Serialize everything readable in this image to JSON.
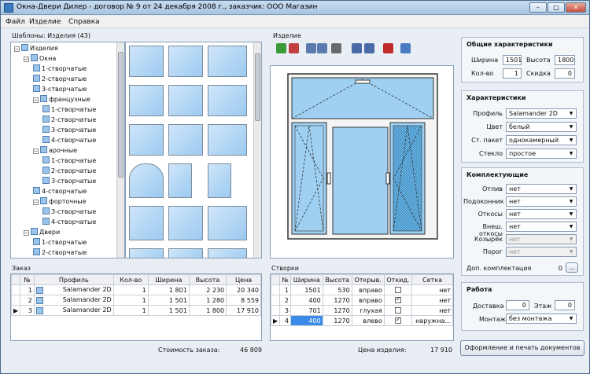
{
  "window": {
    "title": "Окна-Двери Дилер - договор № 9 от 24 декабря 2008 г., заказчик: ООО Магазин",
    "min": "–",
    "max": "□",
    "close": "✕"
  },
  "menu": [
    "Файл",
    "Изделие",
    "Справка"
  ],
  "templates": {
    "label": "Шаблоны: Изделия (43)",
    "tree": [
      {
        "text": "Изделия",
        "level": 0,
        "expander": "−"
      },
      {
        "text": "Окна",
        "level": 1,
        "expander": "−"
      },
      {
        "text": "1-створчатые",
        "level": 2
      },
      {
        "text": "2-створчатые",
        "level": 2
      },
      {
        "text": "3-створчатые",
        "level": 2
      },
      {
        "text": "французные",
        "level": 2,
        "expander": "−"
      },
      {
        "text": "1-створчатые",
        "level": 3
      },
      {
        "text": "2-створчатые",
        "level": 3
      },
      {
        "text": "3-створчатые",
        "level": 3
      },
      {
        "text": "4-створчатые",
        "level": 3
      },
      {
        "text": "арочные",
        "level": 2,
        "expander": "−"
      },
      {
        "text": "1-створчатые",
        "level": 3
      },
      {
        "text": "2-створчатые",
        "level": 3
      },
      {
        "text": "3-створчатые",
        "level": 3
      },
      {
        "text": "4-створчатые",
        "level": 2
      },
      {
        "text": "форточные",
        "level": 2,
        "expander": "−"
      },
      {
        "text": "3-створчатые",
        "level": 3
      },
      {
        "text": "4-створчатые",
        "level": 3
      },
      {
        "text": "Двери",
        "level": 1,
        "expander": "−"
      },
      {
        "text": "1-створчатые",
        "level": 2
      },
      {
        "text": "2-створчатые",
        "level": 2
      }
    ]
  },
  "product": {
    "label": "Изделие",
    "toolbar": [
      "zoom-in-icon",
      "zoom-out-icon",
      "align-left-icon",
      "align-right-icon",
      "menu-dropdown-icon",
      "copy-icon",
      "paste-icon",
      "delete-icon",
      "window-icon"
    ]
  },
  "order": {
    "label": "Заказ",
    "columns": [
      "№",
      "Профиль",
      "Кол-во",
      "Ширина",
      "Высота",
      "Цена"
    ],
    "rows": [
      {
        "n": "1",
        "profile": "Salamander 2D",
        "qty": "1",
        "w": "1 801",
        "h": "2 230",
        "price": "20 340"
      },
      {
        "n": "2",
        "profile": "Salamander 2D",
        "qty": "1",
        "w": "1 501",
        "h": "1 280",
        "price": "8 559"
      },
      {
        "n": "3",
        "profile": "Salamander 2D",
        "qty": "1",
        "w": "1 501",
        "h": "1 800",
        "price": "17 910"
      }
    ],
    "total_label": "Стоимость заказа:",
    "total": "46 809"
  },
  "sashes": {
    "label": "Створки",
    "columns": [
      "№",
      "Ширина",
      "Высота",
      "Открыв.",
      "Откид.",
      "Сетка"
    ],
    "rows": [
      {
        "n": "1",
        "w": "1501",
        "h": "530",
        "open": "вправо",
        "tilt": false,
        "net": "нет"
      },
      {
        "n": "2",
        "w": "400",
        "h": "1270",
        "open": "вправо",
        "tilt": true,
        "net": "нет"
      },
      {
        "n": "3",
        "w": "701",
        "h": "1270",
        "open": "глухая",
        "tilt": false,
        "net": "нет"
      },
      {
        "n": "4",
        "w": "400",
        "h": "1270",
        "open": "влево",
        "tilt": true,
        "net": "наружна..."
      }
    ],
    "price_label": "Цена изделия:",
    "price": "17 910"
  },
  "general": {
    "head": "Общие характеристики",
    "width_label": "Ширина",
    "width": "1501",
    "height_label": "Высота",
    "height": "1800",
    "qty_label": "Кол-во",
    "qty": "1",
    "discount_label": "Скидка",
    "discount": "0"
  },
  "specs": {
    "head": "Характеристики",
    "items": [
      {
        "label": "Профиль",
        "value": "Salamander 2D"
      },
      {
        "label": "Цвет",
        "value": "белый"
      },
      {
        "label": "Ст. пакет",
        "value": "однокамерный"
      },
      {
        "label": "Стекло",
        "value": "простое"
      }
    ]
  },
  "accessories": {
    "head": "Комплектующие",
    "items": [
      {
        "label": "Отлив",
        "value": "нет",
        "disabled": false
      },
      {
        "label": "Подоконник",
        "value": "нет",
        "disabled": false
      },
      {
        "label": "Откосы",
        "value": "нет",
        "disabled": false
      },
      {
        "label": "Внеш. откосы",
        "value": "нет",
        "disabled": false
      },
      {
        "label": "Козырёк",
        "value": "нет",
        "disabled": true
      },
      {
        "label": "Порог",
        "value": "нет",
        "disabled": true
      }
    ],
    "extra_label": "Доп. комплектация",
    "extra_value": "0",
    "extra_btn": "..."
  },
  "work": {
    "head": "Работа",
    "delivery_label": "Доставка",
    "delivery": "0",
    "floor_label": "Этаж",
    "floor": "0",
    "install_label": "Монтаж",
    "install": "без монтажа"
  },
  "print_button": "Оформление и печать документов"
}
